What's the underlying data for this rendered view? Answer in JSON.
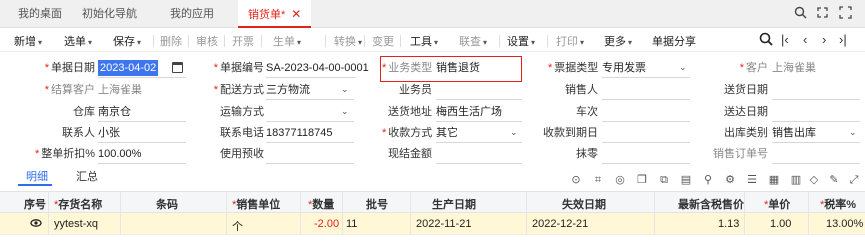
{
  "tabs": [
    {
      "label": "我的桌面"
    },
    {
      "label": "初始化导航"
    },
    {
      "label": "我的应用"
    },
    {
      "label": "销货单",
      "star": "*"
    }
  ],
  "window_icons": [
    "search-icon",
    "restore-icon",
    "fullscreen-icon",
    "close-icon"
  ],
  "toolbar": {
    "add": "新增",
    "pick": "选单",
    "save": "保存",
    "delete": "删除",
    "audit": "审核",
    "invoice": "开票",
    "gen": "生单",
    "convert": "转换",
    "change": "变更",
    "tools": "工具",
    "query": "联查",
    "settings": "设置",
    "print": "打印",
    "more": "更多",
    "share": "单据分享"
  },
  "form": {
    "doc_date": {
      "label": "单据日期",
      "value": "2023-04-02"
    },
    "doc_no": {
      "label": "单据编号",
      "value": "SA-2023-04-00-0001"
    },
    "biz_type": {
      "label": "业务类型",
      "value": "销售退货"
    },
    "bill_type": {
      "label": "票据类型",
      "value": "专用发票"
    },
    "customer": {
      "label": "客户",
      "value": "上海雀巢"
    },
    "settle_customer": {
      "label": "结算客户",
      "value": "上海雀巢"
    },
    "delivery": {
      "label": "配送方式",
      "value": "三方物流"
    },
    "salesman": {
      "label": "业务员"
    },
    "sales_person": {
      "label": "销售人"
    },
    "ship_date": {
      "label": "送货日期"
    },
    "warehouse": {
      "label": "仓库",
      "value": "南京仓"
    },
    "transport": {
      "label": "运输方式"
    },
    "ship_addr": {
      "label": "送货地址",
      "value": "梅西生活广场"
    },
    "train_no": {
      "label": "车次"
    },
    "arrive_date": {
      "label": "送达日期"
    },
    "contact": {
      "label": "联系人",
      "value": "小张"
    },
    "phone": {
      "label": "联系电话",
      "value": "18377118745"
    },
    "payment": {
      "label": "收款方式",
      "value": "其它"
    },
    "pay_date": {
      "label": "收款到期日"
    },
    "out_type": {
      "label": "出库类别",
      "value": "销售出库"
    },
    "discount": {
      "label": "整单折扣%",
      "value": "100.00%"
    },
    "prepay": {
      "label": "使用预收"
    },
    "cash": {
      "label": "现结金额"
    },
    "round": {
      "label": "抹零"
    },
    "order_no": {
      "label": "销售订单号"
    }
  },
  "subtabs": {
    "detail": "明细",
    "summary": "汇总"
  },
  "table": {
    "headers": {
      "seq": "序号",
      "item": "存货名称",
      "barcode": "条码",
      "unit": "销售单位",
      "qty": "数量",
      "batch": "批号",
      "mfg": "生产日期",
      "exp": "失效日期",
      "price": "最新含税售价",
      "unit_price": "单价",
      "tax": "税率%"
    },
    "row": {
      "item": "yytest-xq",
      "unit": "个",
      "qty": "-2.00",
      "batch": "11",
      "mfg": "2022-11-21",
      "exp": "2022-12-21",
      "price": "1.13",
      "unit_price": "1.00",
      "tax": "13.00%"
    }
  }
}
